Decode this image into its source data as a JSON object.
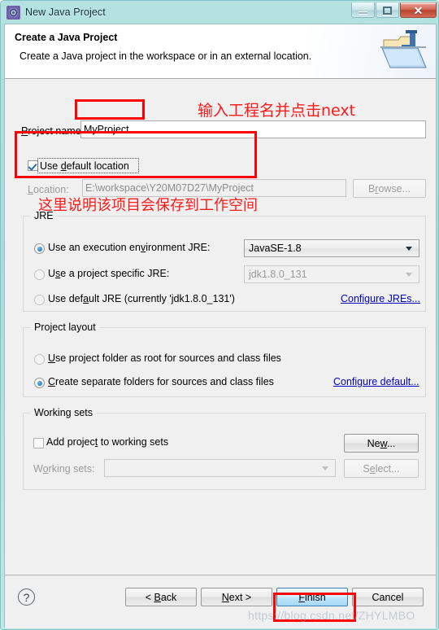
{
  "window": {
    "title": "New Java Project",
    "icon": "eclipse-wizard-icon",
    "caption": {
      "minimize": "minimize-icon",
      "maximize": "maximize-icon",
      "close": "✕"
    }
  },
  "banner": {
    "title": "Create a Java Project",
    "subtitle": "Create a Java project in the workspace or in an external location.",
    "icon": "java-project-folder-icon"
  },
  "project_name": {
    "label_prefix": "P",
    "label": "roject nam",
    "label_suffix": "e:",
    "label_full": "Project name:",
    "value": "MyProject",
    "placeholder": ""
  },
  "location": {
    "use_default_checkbox": {
      "label_a": "Use ",
      "label_u": "d",
      "label_b": "efault location",
      "label_full": "Use default location",
      "checked": true
    },
    "location_label": "Location:",
    "location_value": "E:\\workspace\\Y20M07D27\\MyProject",
    "browse_button": "Browse...",
    "browse_enabled": false
  },
  "jre": {
    "legend": "JRE",
    "options": [
      {
        "label_full": "Use an execution environment JRE:",
        "label_a": "Use an execution en",
        "label_u": "v",
        "label_b": "ironment JRE:",
        "selected": true
      },
      {
        "label_full": "Use a project specific JRE:",
        "label_a": "U",
        "label_u": "s",
        "label_b": "e a project specific JRE:",
        "selected": false
      },
      {
        "label_full": "Use default JRE (currently 'jdk1.8.0_131')",
        "label_a": "Use def",
        "label_u": "a",
        "label_b": "ult JRE (currently 'jdk1.8.0_131')",
        "selected": false
      }
    ],
    "execution_env_value": "JavaSE-1.8",
    "specific_jre_value": "jdk1.8.0_131",
    "specific_jre_enabled": false,
    "configure_link": "Configure JREs..."
  },
  "project_layout": {
    "legend": "Project layout",
    "options": [
      {
        "label_full": "Use project folder as root for sources and class files",
        "label_a": "",
        "label_u": "U",
        "label_b": "se project folder as root for sources and class files",
        "selected": false
      },
      {
        "label_full": "Create separate folders for sources and class files",
        "label_a": "",
        "label_u": "C",
        "label_b": "reate separate folders for sources and class files",
        "selected": true
      }
    ],
    "configure_link": "Configure default..."
  },
  "working_sets": {
    "legend": "Working sets",
    "add_checkbox": {
      "label_a": "Add projec",
      "label_u": "t",
      "label_b": " to working sets",
      "label_full": "Add project to working sets",
      "checked": false
    },
    "new_button": "New...",
    "working_sets_label": "Working sets:",
    "working_sets_value": "",
    "select_button": "Select...",
    "select_enabled": false
  },
  "buttons": {
    "help": "?",
    "back": "< Back",
    "back_a": "< ",
    "back_u": "B",
    "back_b": "ack",
    "next": "Next >",
    "next_a": "",
    "next_u": "N",
    "next_b": "ext >",
    "finish": "Finish",
    "finish_a": "",
    "finish_u": "F",
    "finish_b": "inish",
    "cancel": "Cancel"
  },
  "annotations": {
    "project_name_note": "输入工程名并点击next",
    "workspace_note": "这里说明该项目会保存到工作空间",
    "box_color": "#ff0000",
    "text_color": "#ff1a1a"
  },
  "watermark": "https://blog.csdn.net/ZHYLMBO"
}
